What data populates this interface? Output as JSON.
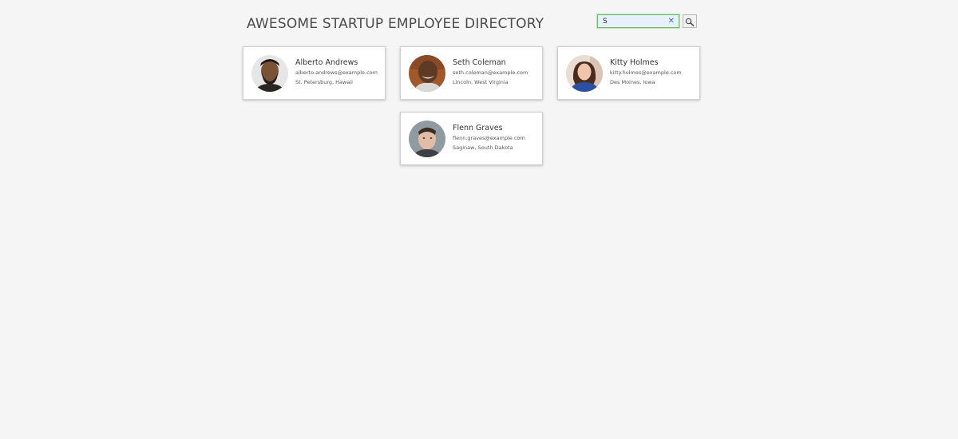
{
  "header": {
    "title": "AWESOME STARTUP EMPLOYEE DIRECTORY"
  },
  "search": {
    "value": "S",
    "clear_icon": "close-icon",
    "button_icon": "search-icon"
  },
  "employees": [
    {
      "name": "Alberto Andrews",
      "email": "alberto.andrews@example.com",
      "location": "St. Petersburg, Hawaii"
    },
    {
      "name": "Seth Coleman",
      "email": "seth.coleman@example.com",
      "location": "Lincoln, West Virginia"
    },
    {
      "name": "Kitty Holmes",
      "email": "kitty.holmes@example.com",
      "location": "Des Moines, Iowa"
    },
    {
      "name": "Flenn Graves",
      "email": "flenn.graves@example.com",
      "location": "Saginaw, South Dakota"
    }
  ],
  "colors": {
    "background": "#f5f5f5",
    "card": "#ffffff",
    "search_focus_border": "#6dbf6a",
    "search_fill": "#e8f0fe"
  }
}
